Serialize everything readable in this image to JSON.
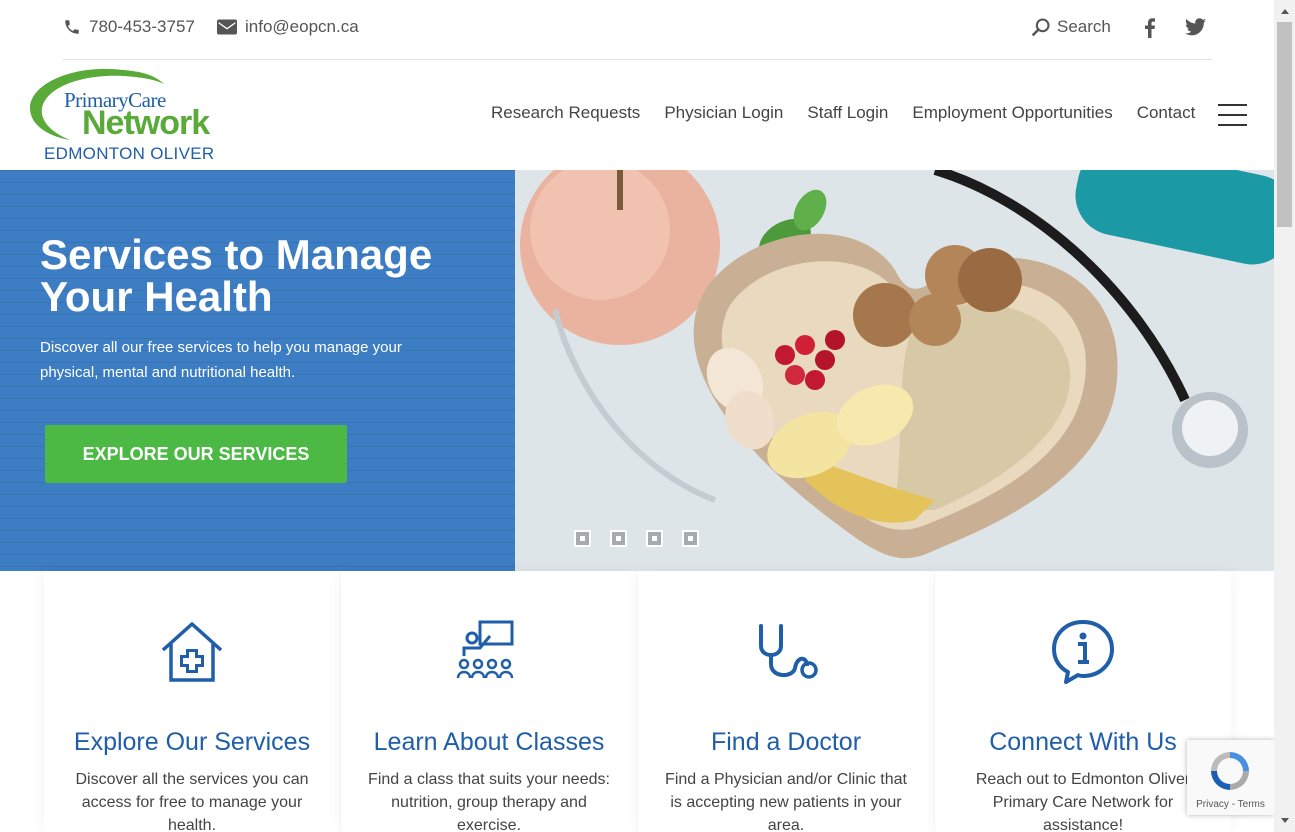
{
  "topbar": {
    "phone": "780-453-3757",
    "email": "info@eopcn.ca",
    "search_label": "Search",
    "social": [
      "facebook-icon",
      "twitter-icon"
    ]
  },
  "logo": {
    "line1": "PrimaryCare",
    "line2": "Network",
    "line3": "EDMONTON OLIVER"
  },
  "nav": {
    "items": [
      {
        "label": "Research Requests"
      },
      {
        "label": "Physician Login"
      },
      {
        "label": "Staff Login"
      },
      {
        "label": "Employment Opportunities"
      },
      {
        "label": "Contact"
      }
    ]
  },
  "hero": {
    "title": "Services to Manage Your Health",
    "subtitle": "Discover all our free services to help you manage your physical, mental and nutritional health.",
    "button_label": "EXPLORE OUR SERVICES",
    "slides": 4,
    "active_slide": 4
  },
  "cards": [
    {
      "icon": "home-health-icon",
      "title": "Explore Our Services",
      "text": "Discover all the services you can access for free to manage your health."
    },
    {
      "icon": "classroom-icon",
      "title": "Learn About Classes",
      "text": "Find a class that suits your needs: nutrition, group therapy and exercise."
    },
    {
      "icon": "stethoscope-icon",
      "title": "Find a Doctor",
      "text": "Find a Physician and/or Clinic that is accepting new patients in your area."
    },
    {
      "icon": "info-bubble-icon",
      "title": "Connect With Us",
      "text": "Reach out to Edmonton Oliver Primary Care Network for assistance!"
    }
  ],
  "recaptcha": {
    "links": "Privacy - Terms"
  },
  "colors": {
    "brand_blue": "#1f5ea8",
    "hero_blue": "#3d7dc4",
    "cta_green": "#4cb944",
    "logo_green": "#5aaa3a"
  }
}
